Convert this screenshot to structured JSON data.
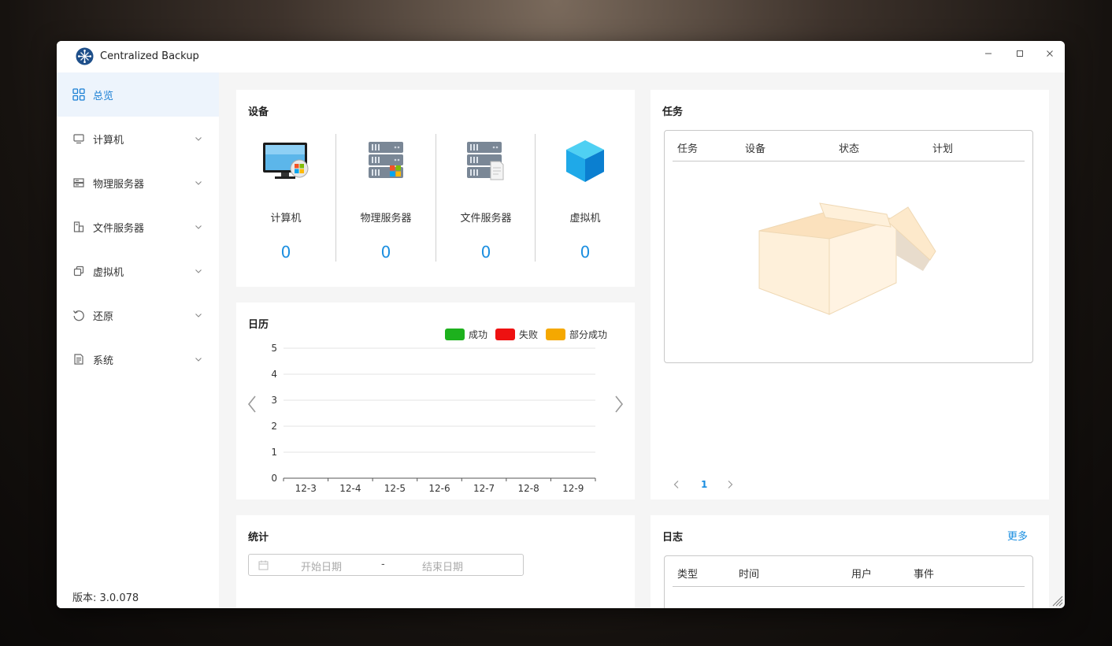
{
  "app": {
    "title": "Centralized Backup",
    "version": "版本: 3.0.078"
  },
  "window_controls": {
    "minimize": "–",
    "maximize": "□",
    "close": "×"
  },
  "sidebar": {
    "items": [
      {
        "label": "总览",
        "icon": "dashboard-icon",
        "active": true
      },
      {
        "label": "计算机",
        "icon": "monitor-icon"
      },
      {
        "label": "物理服务器",
        "icon": "server-icon"
      },
      {
        "label": "文件服务器",
        "icon": "file-server-icon"
      },
      {
        "label": "虚拟机",
        "icon": "vm-icon"
      },
      {
        "label": "还原",
        "icon": "restore-icon"
      },
      {
        "label": "系统",
        "icon": "system-icon"
      }
    ]
  },
  "devices": {
    "title": "设备",
    "items": [
      {
        "label": "计算机",
        "count": "0"
      },
      {
        "label": "物理服务器",
        "count": "0"
      },
      {
        "label": "文件服务器",
        "count": "0"
      },
      {
        "label": "虚拟机",
        "count": "0"
      }
    ]
  },
  "calendar": {
    "title": "日历",
    "legend": [
      {
        "label": "成功",
        "color": "#1db11d"
      },
      {
        "label": "失败",
        "color": "#ee1111"
      },
      {
        "label": "部分成功",
        "color": "#f5a800"
      }
    ]
  },
  "chart_data": {
    "type": "bar",
    "categories": [
      "12-3",
      "12-4",
      "12-5",
      "12-6",
      "12-7",
      "12-8",
      "12-9"
    ],
    "series": [
      {
        "name": "成功",
        "values": [
          0,
          0,
          0,
          0,
          0,
          0,
          0
        ]
      },
      {
        "name": "失败",
        "values": [
          0,
          0,
          0,
          0,
          0,
          0,
          0
        ]
      },
      {
        "name": "部分成功",
        "values": [
          0,
          0,
          0,
          0,
          0,
          0,
          0
        ]
      }
    ],
    "ylim": [
      0,
      5
    ],
    "yticks": [
      "0",
      "1",
      "2",
      "3",
      "4",
      "5"
    ],
    "grid": true,
    "legend_position": "top-right"
  },
  "tasks": {
    "title": "任务",
    "columns": [
      "任务",
      "设备",
      "状态",
      "计划"
    ],
    "page": "1"
  },
  "stats": {
    "title": "统计",
    "start_placeholder": "开始日期",
    "separator": "-",
    "end_placeholder": "结束日期"
  },
  "logs": {
    "title": "日志",
    "more": "更多",
    "columns": [
      "类型",
      "时间",
      "用户",
      "事件"
    ]
  }
}
